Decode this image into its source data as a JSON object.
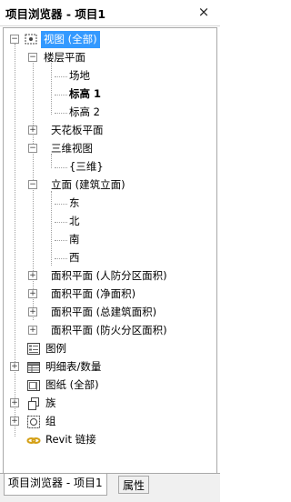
{
  "window": {
    "title": "项目浏览器 - 项目1",
    "close_label": "×"
  },
  "tree": {
    "views": {
      "label": "视图 (全部)",
      "expander": "−"
    },
    "floor_plans": {
      "label": "楼层平面",
      "expander": "−"
    },
    "site": {
      "label": "场地"
    },
    "level1": {
      "label": "标高 1"
    },
    "level2": {
      "label": "标高 2"
    },
    "ceiling_plans": {
      "label": "天花板平面",
      "expander": "+"
    },
    "views_3d": {
      "label": "三维视图",
      "expander": "−"
    },
    "view_3d_item": {
      "label": "{三维}"
    },
    "elevations": {
      "label": "立面 (建筑立面)",
      "expander": "−"
    },
    "east": {
      "label": "东"
    },
    "north": {
      "label": "北"
    },
    "south": {
      "label": "南"
    },
    "west": {
      "label": "西"
    },
    "area_civil": {
      "label": "面积平面 (人防分区面积)",
      "expander": "+"
    },
    "area_net": {
      "label": "面积平面 (净面积)",
      "expander": "+"
    },
    "area_gross": {
      "label": "面积平面 (总建筑面积)",
      "expander": "+"
    },
    "area_fire": {
      "label": "面积平面 (防火分区面积)",
      "expander": "+"
    },
    "legends": {
      "label": "图例"
    },
    "schedules": {
      "label": "明细表/数量",
      "expander": "+"
    },
    "sheets": {
      "label": "图纸 (全部)"
    },
    "families": {
      "label": "族",
      "expander": "+"
    },
    "groups": {
      "label": "组",
      "expander": "+"
    },
    "revit_links": {
      "label": "Revit 链接"
    }
  },
  "tabs": [
    {
      "label": "项目浏览器 - 项目1"
    },
    {
      "label": "属性"
    }
  ],
  "colors": {
    "selection": "#3399ff",
    "link_icon": "#d4a017"
  },
  "icons": {
    "views": "views-icon",
    "legends": "legend-icon",
    "schedules": "schedule-icon",
    "sheets": "sheet-icon",
    "families": "family-icon",
    "groups": "group-icon",
    "revit_links": "link-icon"
  }
}
